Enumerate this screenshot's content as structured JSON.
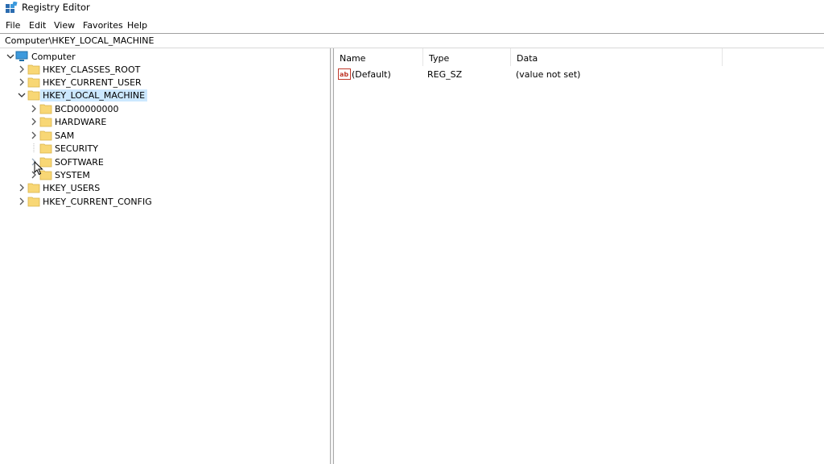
{
  "window": {
    "title": "Registry Editor"
  },
  "menu": [
    "File",
    "Edit",
    "View",
    "Favorites",
    "Help"
  ],
  "address": "Computer\\HKEY_LOCAL_MACHINE",
  "tree": {
    "root": "Computer",
    "hives": [
      "HKEY_CLASSES_ROOT",
      "HKEY_CURRENT_USER",
      "HKEY_LOCAL_MACHINE",
      "HKEY_USERS",
      "HKEY_CURRENT_CONFIG"
    ],
    "hklm_children": [
      "BCD00000000",
      "HARDWARE",
      "SAM",
      "SECURITY",
      "SOFTWARE",
      "SYSTEM"
    ],
    "selected": "HKEY_LOCAL_MACHINE"
  },
  "values": {
    "columns": [
      "Name",
      "Type",
      "Data"
    ],
    "rows": [
      {
        "name": "(Default)",
        "type": "REG_SZ",
        "data": "(value not set)",
        "icon": "string-value-icon"
      }
    ]
  },
  "colors": {
    "selection": "#cce8ff",
    "folder": "#f8d775",
    "computer": "#3c99dc"
  }
}
